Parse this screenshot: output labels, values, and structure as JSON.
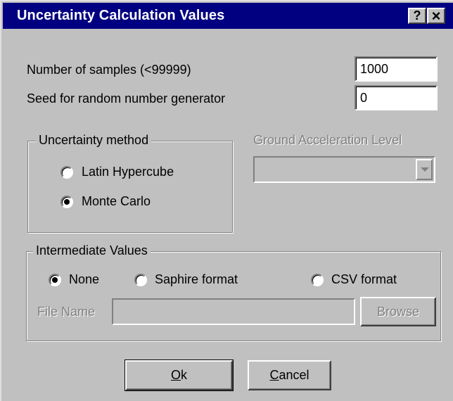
{
  "window": {
    "title": "Uncertainty Calculation Values",
    "help_label": "?",
    "close_label": "×"
  },
  "samples": {
    "label": "Number of samples (<99999)",
    "value": "1000"
  },
  "seed": {
    "label": "Seed for random number generator",
    "value": "0"
  },
  "uncertainty_method": {
    "legend": "Uncertainty method",
    "options": [
      {
        "label": "Latin Hypercube",
        "selected": false
      },
      {
        "label": "Monte Carlo",
        "selected": true
      }
    ]
  },
  "ground_acceleration": {
    "label": "Ground Acceleration Level",
    "value": "",
    "enabled": false
  },
  "intermediate_values": {
    "legend": "Intermediate Values",
    "options": [
      {
        "label": "None",
        "selected": true
      },
      {
        "label": "Saphire format",
        "selected": false
      },
      {
        "label": "CSV format",
        "selected": false
      }
    ],
    "file_name_label": "File Name",
    "file_name_value": "",
    "browse_label": "Browse"
  },
  "buttons": {
    "ok_mnemonic": "O",
    "ok_rest": "k",
    "cancel_mnemonic": "C",
    "cancel_rest": "ancel"
  },
  "colors": {
    "titlebar": "#000080",
    "face": "#c0c0c0",
    "disabled_text": "#808080"
  },
  "icons": {
    "help": "question-mark",
    "close": "x-mark",
    "dropdown": "down-arrow"
  }
}
